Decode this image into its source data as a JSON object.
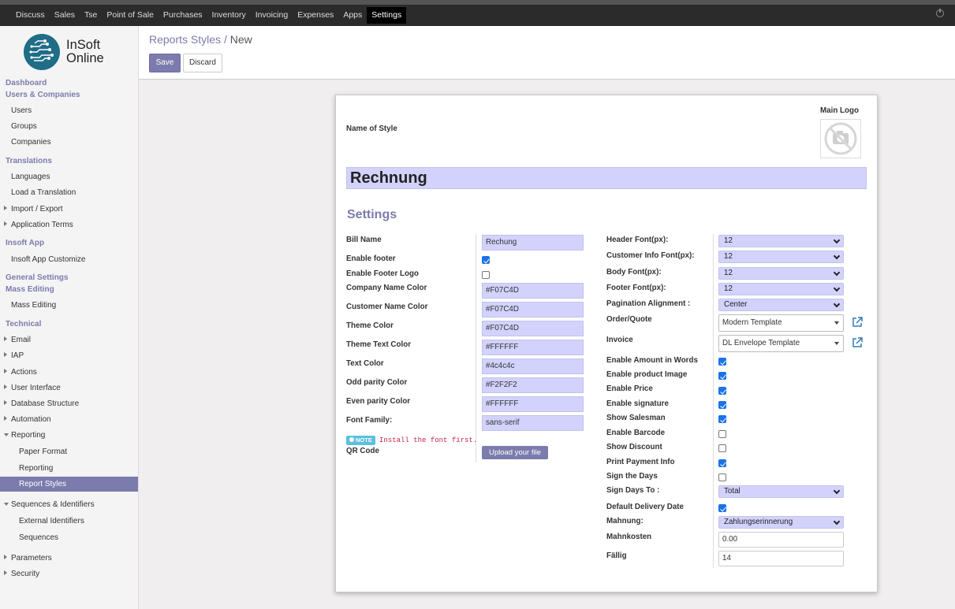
{
  "topbar": {
    "menu": [
      "Discuss",
      "Sales",
      "Tse",
      "Point of Sale",
      "Purchases",
      "Inventory",
      "Invoicing",
      "Expenses",
      "Apps",
      "Settings"
    ],
    "active": "Settings"
  },
  "logo": {
    "line1": "InSoft",
    "line2": "Online"
  },
  "sidebar": {
    "dashboard": "Dashboard",
    "users_companies": "Users & Companies",
    "users": "Users",
    "groups": "Groups",
    "companies": "Companies",
    "translations": "Translations",
    "languages": "Languages",
    "load_translation": "Load a Translation",
    "import_export": "Import / Export",
    "application_terms": "Application Terms",
    "insoft_app": "Insoft App",
    "insoft_app_customize": "Insoft App Customize",
    "general_settings": "General Settings",
    "mass_editing_header": "Mass Editing",
    "mass_editing": "Mass Editing",
    "technical": "Technical",
    "email": "Email",
    "iap": "IAP",
    "actions": "Actions",
    "user_interface": "User Interface",
    "database_structure": "Database Structure",
    "automation": "Automation",
    "reporting": "Reporting",
    "paper_format": "Paper Format",
    "reporting_sub": "Reporting",
    "report_styles": "Report Styles",
    "sequences_identifiers": "Sequences & Identifiers",
    "external_identifiers": "External Identifiers",
    "sequences": "Sequences",
    "parameters": "Parameters",
    "security": "Security"
  },
  "breadcrumb": {
    "parent": "Reports Styles",
    "sep": "/",
    "current": "New"
  },
  "buttons": {
    "save": "Save",
    "discard": "Discard"
  },
  "form": {
    "name_of_style_label": "Name of Style",
    "main_logo_label": "Main Logo",
    "name_value": "Rechnung",
    "settings_title": "Settings",
    "left": {
      "bill_name_label": "Bill Name",
      "bill_name_value": "Rechung",
      "enable_footer_label": "Enable footer",
      "enable_footer": true,
      "enable_footer_logo_label": "Enable Footer Logo",
      "enable_footer_logo": false,
      "company_name_color_label": "Company Name Color",
      "company_name_color": "#F07C4D",
      "customer_name_color_label": "Customer Name Color",
      "customer_name_color": "#F07C4D",
      "theme_color_label": "Theme Color",
      "theme_color": "#F07C4D",
      "theme_text_color_label": "Theme Text Color",
      "theme_text_color": "#FFFFFF",
      "text_color_label": "Text Color",
      "text_color": "#4c4c4c",
      "odd_parity_color_label": "Odd parity Color",
      "odd_parity_color": "#F2F2F2",
      "even_parity_color_label": "Even parity Color",
      "even_parity_color": "#FFFFFF",
      "font_family_label": "Font Family:",
      "font_family": "sans-serif",
      "note_badge": "NOTE",
      "note_text": "Install the font first.",
      "qr_code_label": "QR Code",
      "upload_button": "Upload your file"
    },
    "right": {
      "header_font_label": "Header Font(px):",
      "header_font": "12",
      "customer_info_font_label": "Customer Info Font(px):",
      "customer_info_font": "12",
      "body_font_label": "Body Font(px):",
      "body_font": "12",
      "footer_font_label": "Footer Font(px):",
      "footer_font": "12",
      "pagination_alignment_label": "Pagination Alignment :",
      "pagination_alignment": "Center",
      "order_quote_label": "Order/Quote",
      "order_quote": "Modern Template",
      "invoice_label": "Invoice",
      "invoice": "DL Envelope Template",
      "enable_amount_words_label": "Enable Amount in Words",
      "enable_amount_words": true,
      "enable_product_image_label": "Enable product Image",
      "enable_product_image": true,
      "enable_price_label": "Enable Price",
      "enable_price": true,
      "enable_signature_label": "Enable signature",
      "enable_signature": true,
      "show_salesman_label": "Show Salesman",
      "show_salesman": true,
      "enable_barcode_label": "Enable Barcode",
      "enable_barcode": false,
      "show_discount_label": "Show Discount",
      "show_discount": false,
      "print_payment_info_label": "Print Payment Info",
      "print_payment_info": true,
      "sign_the_days_label": "Sign the Days",
      "sign_the_days": false,
      "sign_days_to_label": "Sign Days To :",
      "sign_days_to": "Total",
      "default_delivery_date_label": "Default Delivery Date",
      "default_delivery_date": true,
      "mahnung_label": "Mahnung:",
      "mahnung": "Zahlungserinnerung",
      "mahnkosten_label": "Mahnkosten",
      "mahnkosten": "0.00",
      "faellig_label": "Fällig",
      "faellig": "14"
    }
  },
  "colors": {
    "accent": "#7c7bad",
    "field_bg": "#d2d2fd",
    "checkbox": "#1a73e8",
    "note_badge": "#5bc0de",
    "note_text": "#c7254e"
  }
}
